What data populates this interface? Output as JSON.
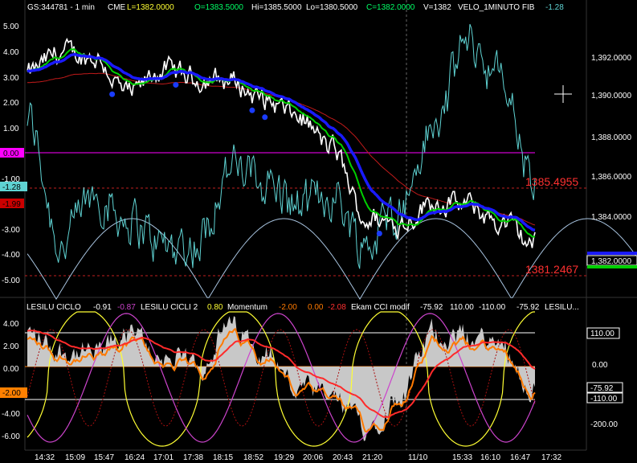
{
  "header": {
    "symbol": "GS:344781 - 1 min",
    "exchange": "CME",
    "last": "L=1382.0000",
    "open": "O=1383.5000",
    "high": "Hi=1385.5000",
    "low": "Lo=1380.5000",
    "close": "C=1382.0000",
    "volume": "V=1382",
    "study": "VELO_1MINUTO FIB",
    "study_value": "-1.28"
  },
  "colors": {
    "background": "#000000",
    "price": "#ffffff",
    "velo": "#5fd3d3",
    "ma_fast": "#00d000",
    "ma_slow": "#1a1aff",
    "ma_long": "#c01a1a",
    "arcs": "#a8c4e0",
    "dots_high": "#ff1a1a",
    "dots_low": "#1a3cff",
    "magenta_line": "#cc00cc",
    "momentum": "#ff7a00",
    "ciclo2": "#ffff33",
    "cci_fill": "#c8c8c8",
    "cci_line": "#ff2a2a",
    "cycle_magenta": "#cc44cc"
  },
  "upper": {
    "left_ticks": [
      "5.00",
      "4.00",
      "3.00",
      "2.00",
      "1.00",
      "0.00",
      "-1.00",
      "-2.00",
      "-3.00",
      "-4.00",
      "-5.00"
    ],
    "right_ticks": [
      "1,392.0000",
      "1,390.0000",
      "1,388.0000",
      "1,386.0000",
      "1,384.0000"
    ],
    "badge_magenta": "0.00",
    "badge_cyan": "-1.28",
    "badge_red": "-1.99",
    "level_high": "1385.4955",
    "level_low": "1381.2467",
    "price_badge": "1,382.0000"
  },
  "lower": {
    "legend": {
      "ciclo": "LESILU CICLO",
      "ciclo_v1": "-0.91",
      "ciclo_v2": "-0.87",
      "ciclo2": "LESILU CICLI 2",
      "ciclo2_v": "0.80",
      "momentum": "Momentum",
      "mom_v1": "-2.00",
      "mom_v2": "0.00",
      "mom_v3": "-2.08",
      "cci": "Ekam CCI modif",
      "cci_v1": "-75.92",
      "cci_v2": "110.00",
      "cci_v3": "-110.00",
      "cci_v4": "-75.92",
      "more": "LESILU..."
    },
    "left_ticks": [
      "4.00",
      "2.00",
      "0.00",
      "-2.00",
      "-4.00",
      "-6.00"
    ],
    "right_ticks": [
      "110.00",
      "0.00",
      "-75.92",
      "-110.00",
      "-200.00"
    ],
    "badge_orange": "-2.00"
  },
  "time_axis": [
    "14:32",
    "15:09",
    "15:47",
    "16:24",
    "17:01",
    "17:38",
    "18:15",
    "18:52",
    "19:29",
    "20:06",
    "20:43",
    "21:20",
    "11/10",
    "15:33",
    "16:10",
    "16:47",
    "17:32"
  ],
  "chart_data": {
    "type": "line",
    "title": "GS:344781 - 1 min",
    "xlabel": "",
    "ylabel": "",
    "ylim": [
      1379.5,
      1393.5
    ],
    "x": [
      "14:32",
      "15:09",
      "15:47",
      "16:24",
      "17:01",
      "17:38",
      "18:15",
      "18:52",
      "19:29",
      "20:06",
      "20:43",
      "21:20",
      "11/10",
      "15:33",
      "16:10",
      "16:47"
    ],
    "series": [
      {
        "values": [
          1390.0,
          1391.0,
          1390.8,
          1389.0,
          1390.2,
          1389.8,
          1389.7,
          1388.8,
          1388.0,
          1386.5,
          1383.2,
          1383.0,
          1384.0,
          1383.8,
          1383.0,
          1382.0
        ]
      }
    ],
    "velo": [
      1.5,
      -3.5,
      -1.5,
      -2.5,
      -3.5,
      -3.5,
      -0.5,
      -1.0,
      -2.0,
      -1.5,
      -3.5,
      -2.0,
      1.0,
      4.5,
      3.0,
      -1.28
    ],
    "cci": [
      110,
      50,
      40,
      110,
      30,
      0,
      130,
      60,
      -80,
      -110,
      -200,
      -100,
      110,
      100,
      70,
      -75.92
    ],
    "levels": {
      "resistance": 1385.4955,
      "support": 1381.2467,
      "last": 1382.0
    }
  }
}
